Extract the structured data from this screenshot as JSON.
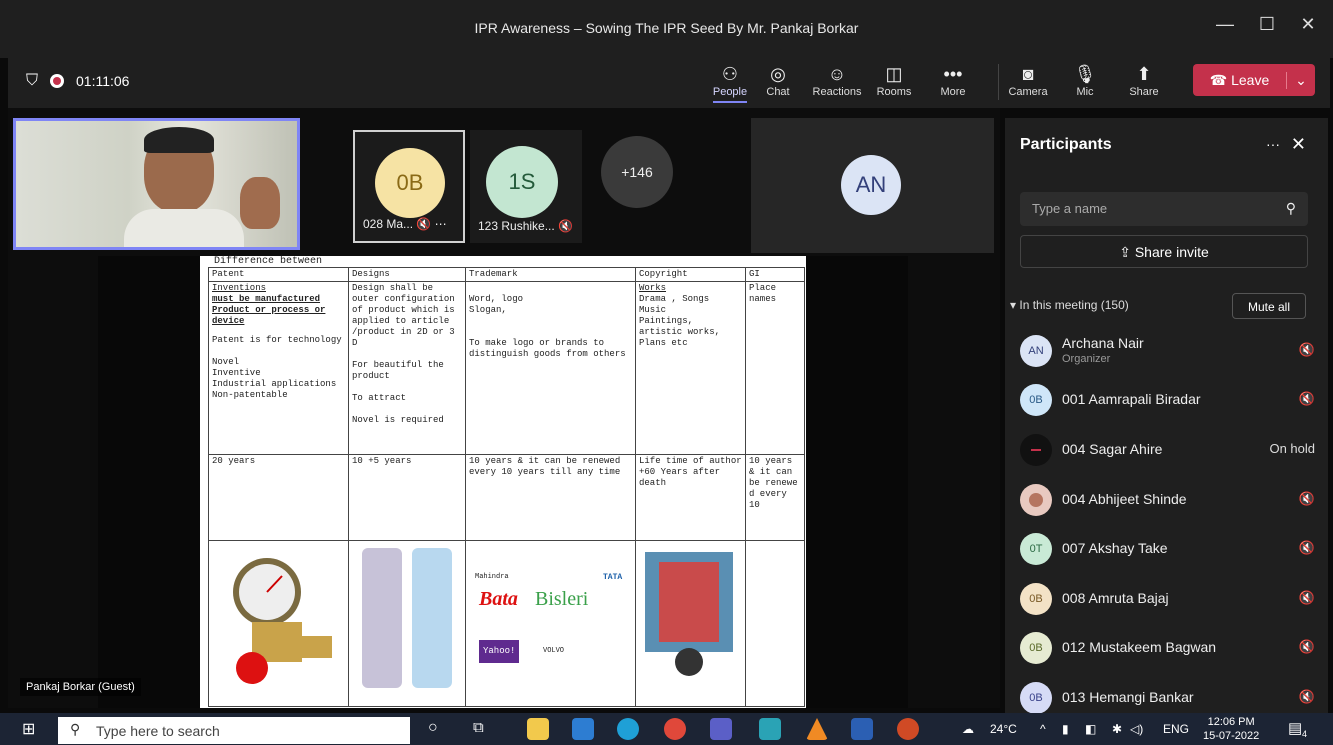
{
  "window": {
    "title": "IPR Awareness – Sowing The IPR Seed By Mr. Pankaj Borkar",
    "minimize": "—",
    "maximize": "☐",
    "close": "✕"
  },
  "toolbar": {
    "timer": "01:11:06",
    "items": [
      {
        "label": "People",
        "icon": "people-icon"
      },
      {
        "label": "Chat",
        "icon": "chat-icon"
      },
      {
        "label": "Reactions",
        "icon": "reactions-icon"
      },
      {
        "label": "Rooms",
        "icon": "rooms-icon"
      },
      {
        "label": "More",
        "icon": "more-icon"
      },
      {
        "label": "Camera",
        "icon": "camera-off-icon"
      },
      {
        "label": "Mic",
        "icon": "mic-off-icon"
      },
      {
        "label": "Share",
        "icon": "share-icon"
      }
    ],
    "leave_label": "Leave"
  },
  "stage": {
    "tiles": [
      {
        "initials": "0B",
        "name": "028 Ma...",
        "color": "#f6e3a4"
      },
      {
        "initials": "1S",
        "name": "123 Rushike...",
        "color": "#c3e6d1"
      },
      {
        "initials": "+146",
        "name": "",
        "color": "#3a3a3a"
      }
    ],
    "an_initials": "AN",
    "presenter_name": "Pankaj Borkar (Guest)"
  },
  "document": {
    "heading": "Difference between",
    "headers": [
      "Patent",
      "Designs",
      "Trademark",
      "Copyright",
      "GI"
    ],
    "row1": {
      "patent_u": [
        "Inventions",
        "must be manufactured",
        "Product or process or device"
      ],
      "patent": "Patent is for technology\n\nNovel\nInventive\nIndustrial applications\nNon-patentable",
      "designs": "Design shall be outer configuration of product which is applied to article /product in 2D or 3 D\n\nFor beautiful the product\n\nTo attract\n\nNovel is required",
      "trademark": "\nWord, logo\nSlogan,\n\n\nTo make logo or brands to distinguish goods from others",
      "copyright_u": "Works",
      "copyright": "Drama , Songs\nMusic\nPaintings,\nartistic works,\nPlans etc",
      "gi": "Place names"
    },
    "row2": {
      "patent": "20 years",
      "designs": "10 +5 years",
      "trademark": "10 years & it can be renewed every 10 years till any time",
      "copyright": "Life time of author +60 Years after death",
      "gi": "10 years & it can be renewe d every 10"
    },
    "brands": [
      "Bata",
      "Bisleri",
      "Mahindra",
      "TATA",
      "Yahoo!",
      "VOLVO"
    ]
  },
  "panel": {
    "title": "Participants",
    "search_placeholder": "Type a name",
    "invite_label": "Share invite",
    "meeting_header": "In this meeting (150)",
    "mute_all": "Mute all",
    "participants": [
      {
        "initials": "AN",
        "name": "Archana Nair",
        "role": "Organizer",
        "status": "",
        "color": "#dbe4f5"
      },
      {
        "initials": "0B",
        "name": "001 Aamrapali Biradar",
        "role": "",
        "status": "",
        "color": "#cfe6f8"
      },
      {
        "initials": "",
        "name": "004 Sagar Ahire",
        "role": "",
        "status": "On hold",
        "color": "#111111"
      },
      {
        "initials": "",
        "name": "004 Abhijeet Shinde",
        "role": "",
        "status": "",
        "color": "#e8c9c0"
      },
      {
        "initials": "0T",
        "name": "007 Akshay Take",
        "role": "",
        "status": "",
        "color": "#c9ead6"
      },
      {
        "initials": "0B",
        "name": "008 Amruta Bajaj",
        "role": "",
        "status": "",
        "color": "#f3e2c6"
      },
      {
        "initials": "0B",
        "name": "012 Mustakeem Bagwan",
        "role": "",
        "status": "",
        "color": "#e6ebd2"
      },
      {
        "initials": "0B",
        "name": "013 Hemangi Bankar",
        "role": "",
        "status": "",
        "color": "#d6dbf6"
      }
    ]
  },
  "taskbar": {
    "search_placeholder": "Type here to search",
    "temperature": "24°C",
    "language": "ENG",
    "time": "12:06 PM",
    "date": "15-07-2022",
    "notifications": "4"
  }
}
